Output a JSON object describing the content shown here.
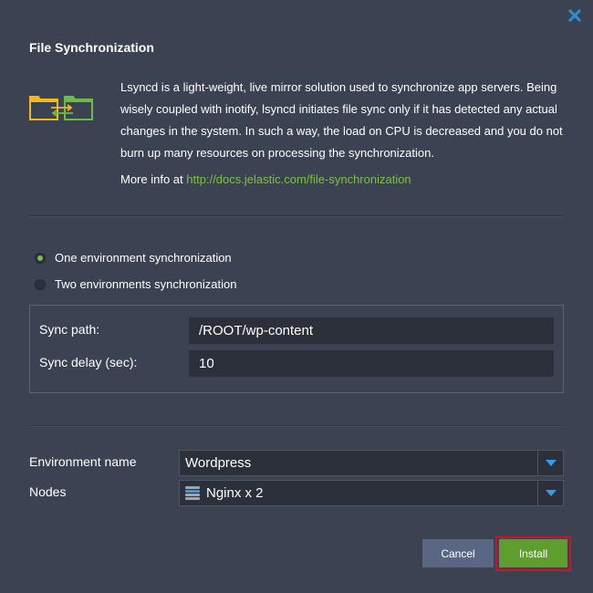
{
  "dialog": {
    "title": "File Synchronization",
    "close_icon": "close-icon"
  },
  "info": {
    "logo_icon": "folder-sync-icon",
    "description": "Lsyncd is a light-weight, live mirror solution used to synchronize app servers. Being wisely coupled with inotify, lsyncd initiates file sync only if it has detected any actual changes in the system. In such a way, the load on CPU is decreased and you do not burn up many resources on processing the synchronization.",
    "more_info_prefix": "More info at",
    "more_info_link": "http://docs.jelastic.com/file-synchronization",
    "link_color": "#7dc04a"
  },
  "sync_mode": {
    "options": [
      {
        "label": "One environment synchronization",
        "checked": true
      },
      {
        "label": "Two environments synchronization",
        "checked": false
      }
    ]
  },
  "sync_settings": {
    "path_label": "Sync path:",
    "path_value": "/ROOT/wp-content",
    "delay_label": "Sync delay (sec):",
    "delay_value": "10"
  },
  "target": {
    "env_label": "Environment name",
    "env_value": "Wordpress",
    "nodes_label": "Nodes",
    "nodes_value": "Nginx x 2",
    "nodes_icon": "server-stack-icon"
  },
  "buttons": {
    "cancel_label": "Cancel",
    "install_label": "Install",
    "install_color": "#5e9e2e",
    "highlight_color": "#d0141f"
  }
}
